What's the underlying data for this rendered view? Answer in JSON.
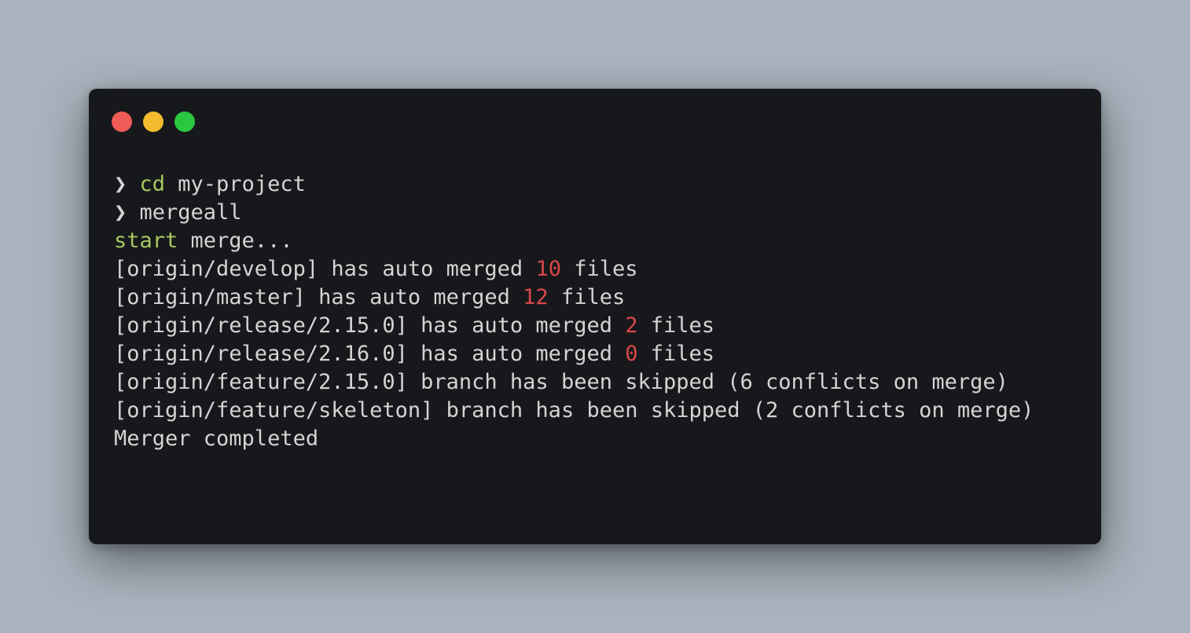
{
  "window": {
    "controls": [
      {
        "name": "close",
        "color": "#ed5c56"
      },
      {
        "name": "minimize",
        "color": "#f4bb2e"
      },
      {
        "name": "maximize",
        "color": "#29c840"
      }
    ]
  },
  "colors": {
    "command": "#a6c860",
    "number": "#d9484b",
    "text": "#d4d4d4",
    "terminal_bg": "#17181b",
    "page_bg": "#a8b3bd"
  },
  "terminal": {
    "prompt_symbol": "❯",
    "lines": [
      {
        "parts": [
          {
            "text": "❯ ",
            "style": "text"
          },
          {
            "text": "cd",
            "style": "command"
          },
          {
            "text": " my-project",
            "style": "text"
          }
        ]
      },
      {
        "parts": [
          {
            "text": "❯ ",
            "style": "text"
          },
          {
            "text": "mergeall",
            "style": "text"
          }
        ]
      },
      {
        "parts": [
          {
            "text": "start",
            "style": "command"
          },
          {
            "text": " merge...",
            "style": "text"
          }
        ]
      },
      {
        "parts": [
          {
            "text": "[origin/develop] has auto merged ",
            "style": "text"
          },
          {
            "text": "10",
            "style": "number"
          },
          {
            "text": " files",
            "style": "text"
          }
        ]
      },
      {
        "parts": [
          {
            "text": "[origin/master] has auto merged ",
            "style": "text"
          },
          {
            "text": "12",
            "style": "number"
          },
          {
            "text": " files",
            "style": "text"
          }
        ]
      },
      {
        "parts": [
          {
            "text": "[origin/release/2.15.0] has auto merged ",
            "style": "text"
          },
          {
            "text": "2",
            "style": "number"
          },
          {
            "text": " files",
            "style": "text"
          }
        ]
      },
      {
        "parts": [
          {
            "text": "[origin/release/2.16.0] has auto merged ",
            "style": "text"
          },
          {
            "text": "0",
            "style": "number"
          },
          {
            "text": " files",
            "style": "text"
          }
        ]
      },
      {
        "parts": [
          {
            "text": "[origin/feature/2.15.0] branch has been skipped (6 conflicts on merge)",
            "style": "text"
          }
        ]
      },
      {
        "parts": [
          {
            "text": "[origin/feature/skeleton] branch has been skipped (2 conflicts on merge)",
            "style": "text"
          }
        ]
      },
      {
        "parts": [
          {
            "text": "Merger completed",
            "style": "text"
          }
        ]
      }
    ]
  }
}
